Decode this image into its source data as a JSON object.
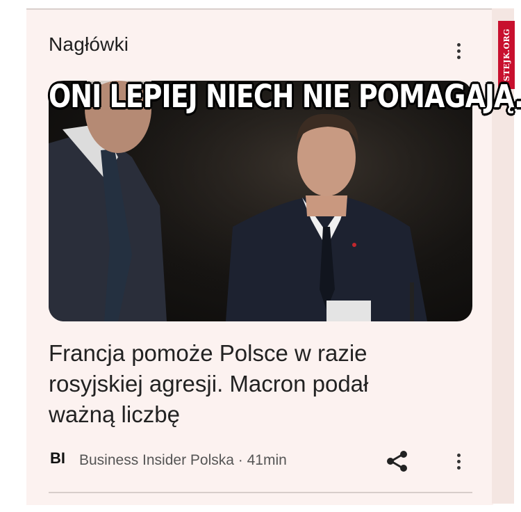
{
  "header": {
    "title": "Nagłówki"
  },
  "watermark": {
    "text": "STEJK.ORG",
    "color": "#c8102e"
  },
  "meme": {
    "caption": "ONI LEPIEJ NIECH NIE POMAGAJĄ..."
  },
  "article": {
    "headline": "Francja pomoże Polsce w razie rosyjskiej agresji. Macron podał ważną liczbę",
    "source_logo": "BI",
    "source_meta": "Business Insider Polska · 41min"
  },
  "icons": {
    "more": "more-vert-icon",
    "share": "share-icon"
  }
}
